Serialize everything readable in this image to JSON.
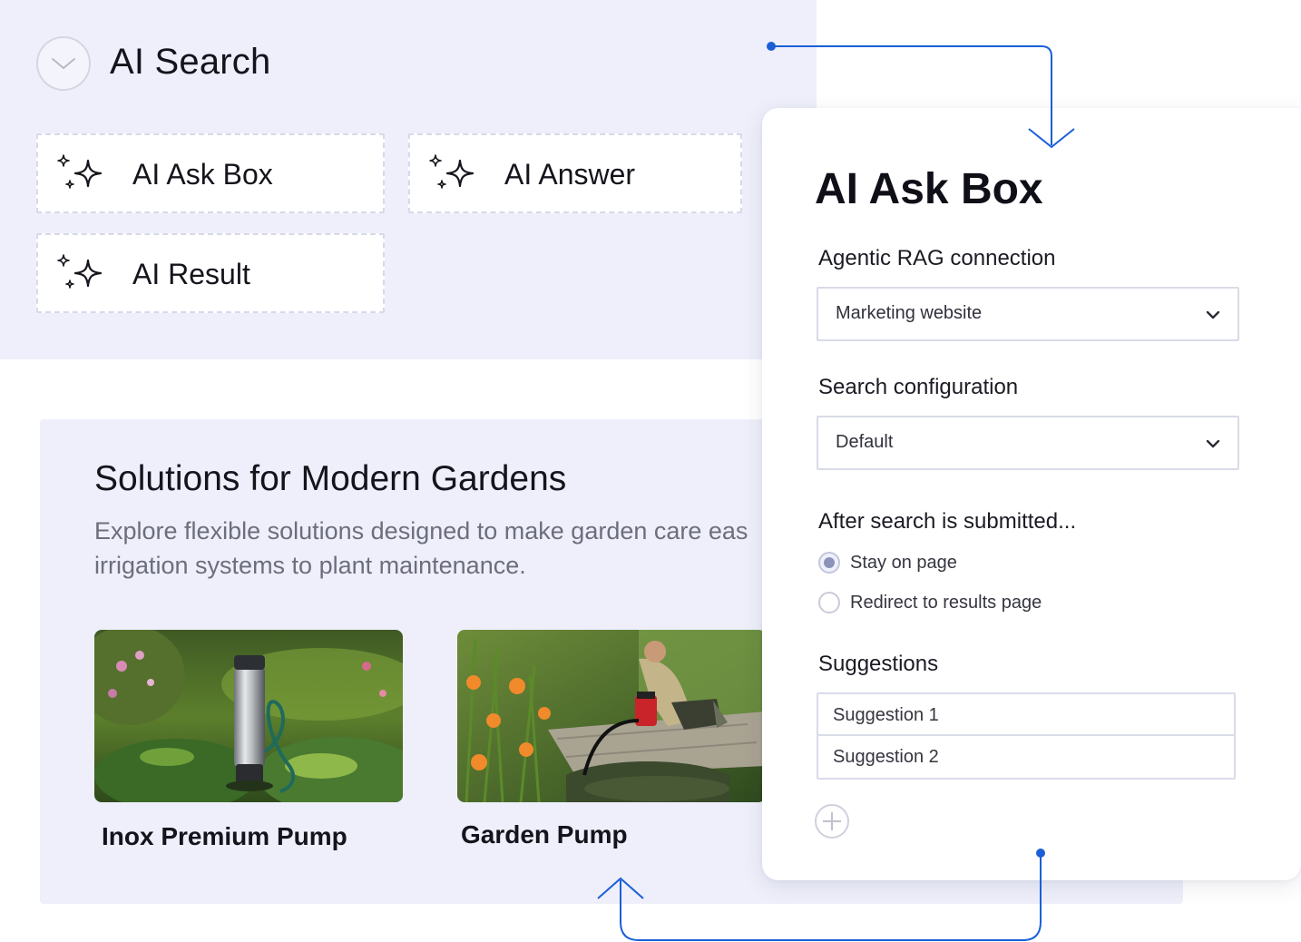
{
  "search_panel": {
    "title": "AI Search",
    "widgets": [
      {
        "label": "AI Ask Box"
      },
      {
        "label": "AI Answer"
      },
      {
        "label": "AI Result"
      }
    ]
  },
  "garden": {
    "title": "Solutions for Modern Gardens",
    "description_line1": "Explore flexible solutions designed to make garden care eas",
    "description_line2": "irrigation systems to plant maintenance.",
    "products": [
      {
        "name": "Inox Premium Pump"
      },
      {
        "name": "Garden Pump"
      }
    ]
  },
  "settings": {
    "title": "AI Ask Box",
    "rag_label": "Agentic RAG connection",
    "rag_value": "Marketing website",
    "search_config_label": "Search configuration",
    "search_config_value": "Default",
    "after_submit_label": "After search is submitted...",
    "options": [
      {
        "label": "Stay on page",
        "selected": true
      },
      {
        "label": "Redirect to results page",
        "selected": false
      }
    ],
    "suggestions_label": "Suggestions",
    "suggestions": [
      "Suggestion 1",
      "Suggestion 2"
    ]
  },
  "colors": {
    "panel_bg": "#eeeffa",
    "connector": "#1a5fd8",
    "card_bg": "#ffffff"
  }
}
